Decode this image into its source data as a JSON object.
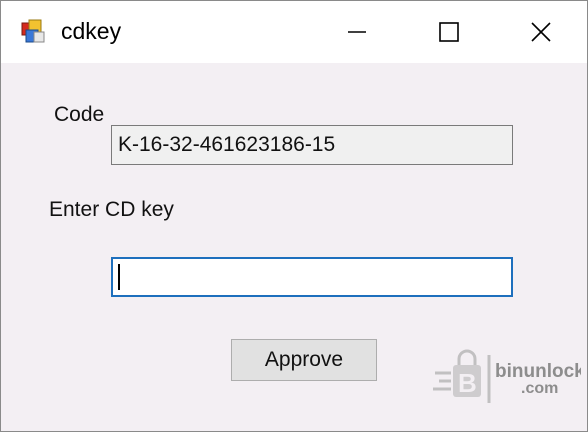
{
  "window": {
    "title": "cdkey",
    "minimize_label": "Minimize",
    "maximize_label": "Maximize",
    "close_label": "Close"
  },
  "form": {
    "code_label": "Code",
    "code_value": "K-16-32-461623186-15",
    "cdkey_label": "Enter CD key",
    "cdkey_value": "",
    "approve_label": "Approve"
  },
  "watermark": {
    "text_main": "binunlock",
    "text_sub": ".com"
  },
  "colors": {
    "focus_border": "#1d6fbd",
    "client_bg": "#f3eff3",
    "titlebar_bg": "#ffffff",
    "button_bg": "#e1e1e1"
  }
}
